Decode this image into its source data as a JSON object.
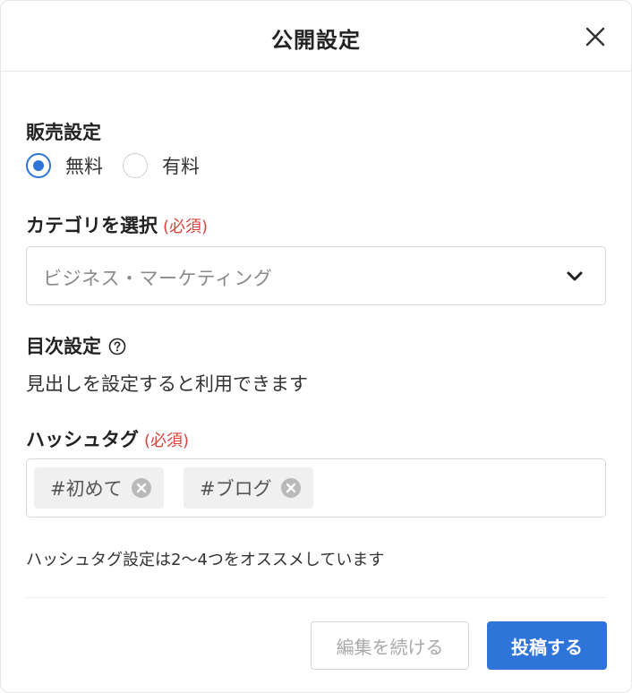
{
  "dialog": {
    "title": "公開設定"
  },
  "sales": {
    "label": "販売設定",
    "options": [
      {
        "label": "無料",
        "selected": true
      },
      {
        "label": "有料",
        "selected": false
      }
    ]
  },
  "category": {
    "label": "カテゴリを選択",
    "required_text": "(必須)",
    "selected_value": "ビジネス・マーケティング"
  },
  "toc": {
    "label": "目次設定",
    "description": "見出しを設定すると利用できます"
  },
  "hashtags": {
    "label": "ハッシュタグ",
    "required_text": "(必須)",
    "tags": [
      "#初めて",
      "#ブログ"
    ],
    "hint": "ハッシュタグ設定は2〜4つをオススメしています"
  },
  "footer": {
    "continue_label": "編集を続ける",
    "post_label": "投稿する"
  },
  "colors": {
    "accent": "#2f74d8",
    "required": "#d9443c"
  }
}
